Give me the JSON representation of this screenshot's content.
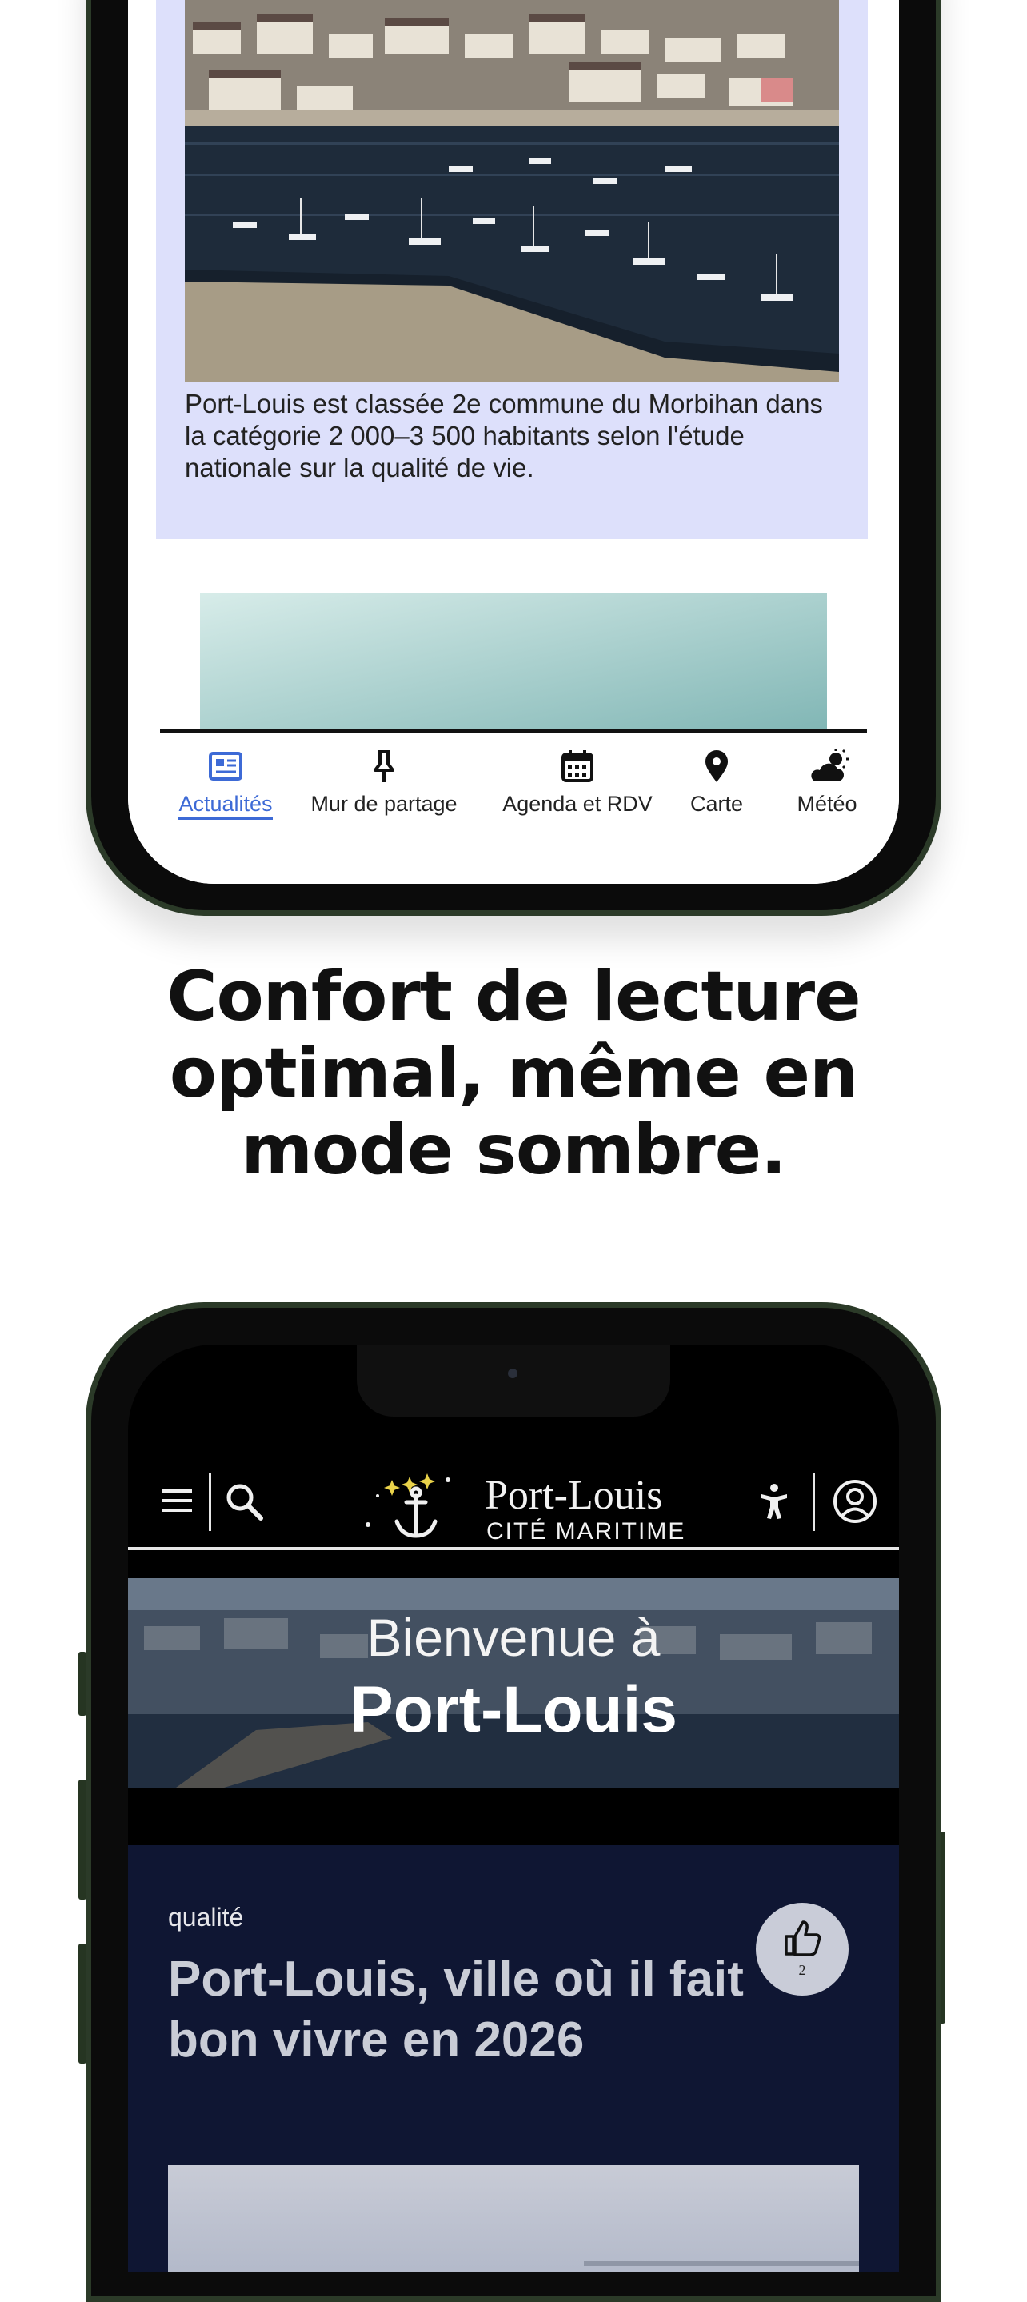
{
  "top_phone": {
    "article_caption": "Port-Louis est classée 2e commune du Morbihan dans la catégorie 2 000–3 500 habitants selon l'étude nationale sur la qualité de vie.",
    "tabs": [
      {
        "label": "Actualités",
        "icon": "newspaper-icon",
        "active": true
      },
      {
        "label": "Mur de partage",
        "icon": "pin-icon",
        "active": false
      },
      {
        "label": "Agenda et RDV",
        "icon": "calendar-icon",
        "active": false
      },
      {
        "label": "Carte",
        "icon": "map-pin-icon",
        "active": false
      },
      {
        "label": "Météo",
        "icon": "weather-icon",
        "active": false
      }
    ],
    "colors": {
      "card_bg": "#dde0fb",
      "active_tab": "#3d6ad6"
    }
  },
  "headline": "Confort de lecture optimal, même en mode sombre.",
  "bottom_phone": {
    "logo": {
      "name": "Port-Louis",
      "subtitle": "CITÉ MARITIME"
    },
    "banner": {
      "line1": "Bienvenue à",
      "line2": "Port-Louis"
    },
    "article": {
      "category": "qualité",
      "title": "Port-Louis, ville où il fait bon vivre en 2026",
      "likes": "2"
    },
    "colors": {
      "card_bg": "#0f1633",
      "background": "#000000"
    }
  }
}
